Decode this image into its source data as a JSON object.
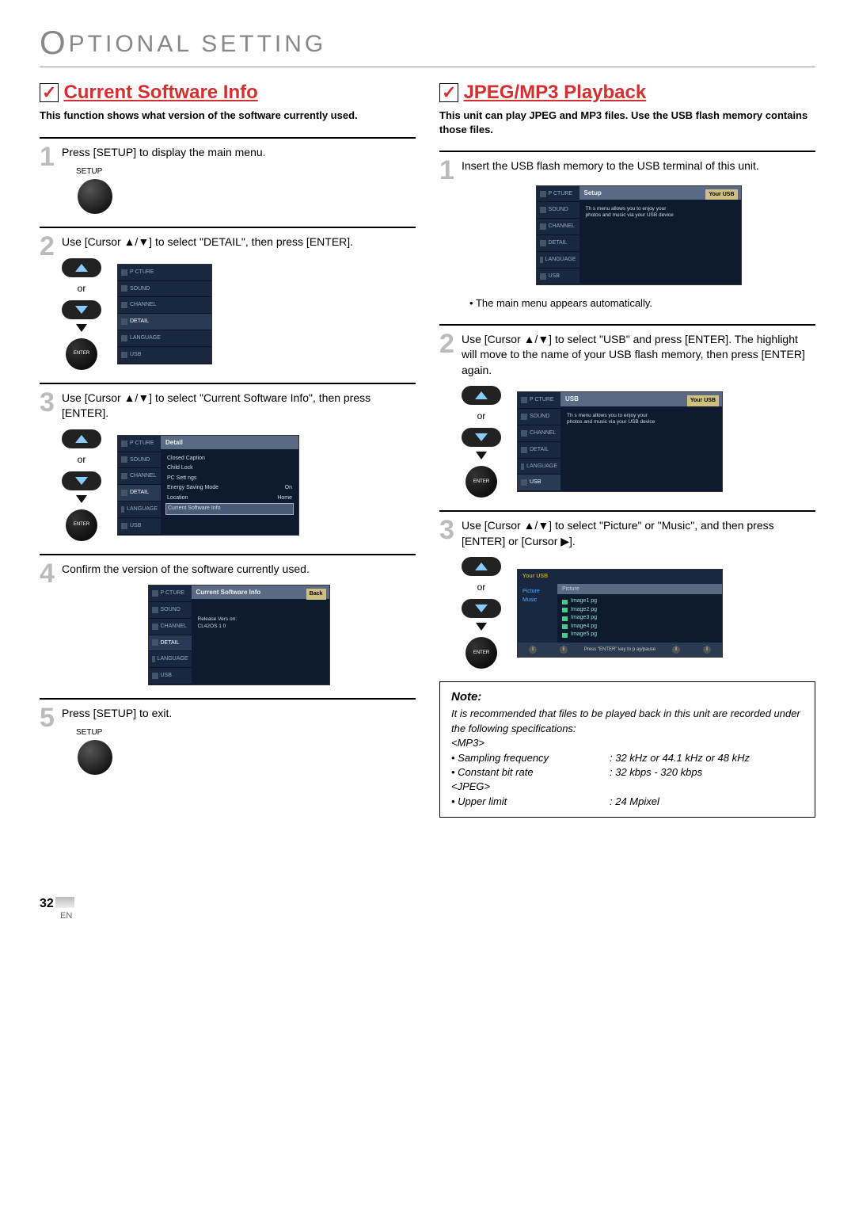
{
  "header": "PTIONAL  SETTING",
  "header_cap": "O",
  "left": {
    "title": "Current Software Info",
    "desc": "This function shows what version of the software currently used.",
    "step1": "Press [SETUP] to display the main menu.",
    "step1_label": "SETUP",
    "step2": "Use [Cursor ▲/▼] to select \"DETAIL\", then press [ENTER].",
    "step3": "Use [Cursor ▲/▼] to select \"Current Software Info\", then press [ENTER].",
    "step4": "Confirm the version of the software currently used.",
    "step5": "Press [SETUP] to exit.",
    "step5_label": "SETUP",
    "or": "or",
    "enter": "ENTER",
    "tv_menu": {
      "items": [
        "P CTURE",
        "SOUND",
        "CHANNEL",
        "DETAIL",
        "LANGUAGE",
        "USB"
      ],
      "detail_header": "Detail",
      "detail_list": [
        {
          "l": "Closed Caption",
          "r": ""
        },
        {
          "l": "Child Lock",
          "r": ""
        },
        {
          "l": "PC Sett ngs",
          "r": ""
        },
        {
          "l": "Energy Saving Mode",
          "r": "On"
        },
        {
          "l": "Location",
          "r": "Home"
        },
        {
          "l": "Current Software Info",
          "r": ""
        }
      ],
      "csi_header": "Current Software Info",
      "csi_back": "Back",
      "csi_release": "Release Vers on:",
      "csi_version": "CL42OS 1 0"
    }
  },
  "right": {
    "title": "JPEG/MP3 Playback",
    "desc": "This unit can play JPEG and MP3 files. Use the USB flash memory contains those files.",
    "step1": "Insert the USB flash memory to the USB terminal of this unit.",
    "step1_sub": "The main menu appears automatically.",
    "step2": "Use [Cursor ▲/▼] to select \"USB\" and press [ENTER]. The highlight will move to the name of your USB flash memory, then press [ENTER] again.",
    "step3": "Use [Cursor ▲/▼] to select \"Picture\" or \"Music\", and then press [ENTER] or [Cursor ▶].",
    "or": "or",
    "enter": "ENTER",
    "tv_setup": {
      "header": "Setup",
      "your_usb": "Your USB",
      "desc": "Th s menu allows you to enjoy your photos and music via your USB device"
    },
    "tv_usb": {
      "header": "USB",
      "your_usb": "Your USB",
      "desc": "Th s menu allows you to enjoy your photos and music via your USB device"
    },
    "browser": {
      "top": "Your USB",
      "left_picture": "Picture",
      "left_music": "Music",
      "right_header": "Picture",
      "files": [
        "Image1  pg",
        "Image2  pg",
        "Image3  pg",
        "Image4  pg",
        "Image5  pg"
      ],
      "bottom": "Press \"ENTER\" key to p ay/pause"
    },
    "note": {
      "title": "Note:",
      "intro": "It is recommended that files to be played back in this unit are recorded under the following specifications:",
      "mp3_header": "<MP3>",
      "sampling_l": "• Sampling frequency",
      "sampling_v": ": 32 kHz or 44.1 kHz or 48 kHz",
      "bitrate_l": "• Constant bit rate",
      "bitrate_v": ": 32 kbps - 320 kbps",
      "jpeg_header": "<JPEG>",
      "upper_l": "• Upper limit",
      "upper_v": ": 24 Mpixel"
    }
  },
  "page_number": "32",
  "page_lang": "EN"
}
